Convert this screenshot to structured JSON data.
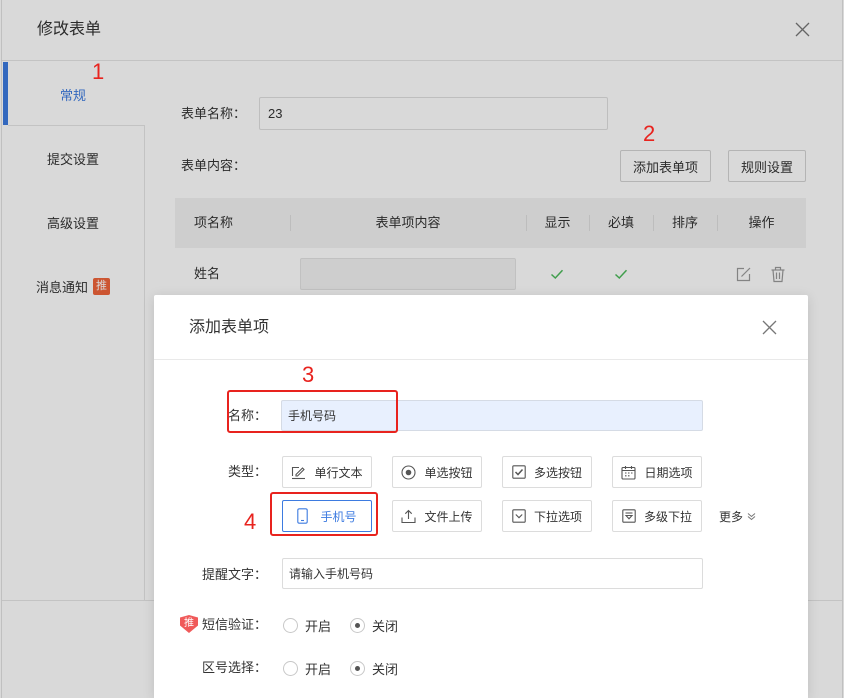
{
  "edit_form_dialog": {
    "title": "修改表单",
    "sidebar": {
      "items": [
        {
          "label": "常规",
          "active": true
        },
        {
          "label": "提交设置",
          "active": false
        },
        {
          "label": "高级设置",
          "active": false
        },
        {
          "label": "消息通知",
          "active": false,
          "badge": "推"
        }
      ]
    },
    "form_name": {
      "label": "表单名称：",
      "value": "23"
    },
    "form_content": {
      "label": "表单内容："
    },
    "buttons": {
      "add_item": "添加表单项",
      "rules": "规则设置"
    },
    "table": {
      "headers": [
        "项名称",
        "表单项内容",
        "显示",
        "必填",
        "排序",
        "操作"
      ],
      "rows": [
        {
          "name": "姓名",
          "show": true,
          "required": true,
          "actions": [
            "edit-icon",
            "delete-icon"
          ]
        }
      ]
    }
  },
  "add_item_dialog": {
    "title": "添加表单项",
    "name": {
      "label": "名称：",
      "value": "手机号码"
    },
    "type": {
      "label": "类型：",
      "options": [
        {
          "label": "单行文本",
          "icon": "text-line-icon",
          "selected": false
        },
        {
          "label": "单选按钮",
          "icon": "radio-icon",
          "selected": false
        },
        {
          "label": "多选按钮",
          "icon": "checkbox-icon",
          "selected": false
        },
        {
          "label": "日期选项",
          "icon": "calendar-icon",
          "selected": false
        },
        {
          "label": "手机号",
          "icon": "phone-icon",
          "selected": true
        },
        {
          "label": "文件上传",
          "icon": "upload-icon",
          "selected": false
        },
        {
          "label": "下拉选项",
          "icon": "dropdown-icon",
          "selected": false
        },
        {
          "label": "多级下拉",
          "icon": "multi-dropdown-icon",
          "selected": false
        }
      ],
      "more": {
        "label": "更多",
        "icon": "chevron-down-icon"
      }
    },
    "hint": {
      "label": "提醒文字：",
      "value": "请输入手机号码"
    },
    "sms_verify": {
      "label": "短信验证：",
      "badge": "推",
      "options": [
        {
          "label": "开启",
          "checked": false
        },
        {
          "label": "关闭",
          "checked": true
        }
      ]
    },
    "area_code": {
      "label": "区号选择：",
      "options": [
        {
          "label": "开启",
          "checked": false
        },
        {
          "label": "关闭",
          "checked": true
        }
      ]
    }
  },
  "annotations": {
    "step1": "1",
    "step2": "2",
    "step3": "3",
    "step4": "4"
  },
  "colors": {
    "accent": "#3d7be0",
    "annotation_red": "#e8231e",
    "badge": "#f0643a",
    "shield_badge": "#f05a5a",
    "check_green": "#4cba5a",
    "name_input_bg": "#e8f0fe",
    "overlay": "rgba(0,0,0,0.15)"
  }
}
